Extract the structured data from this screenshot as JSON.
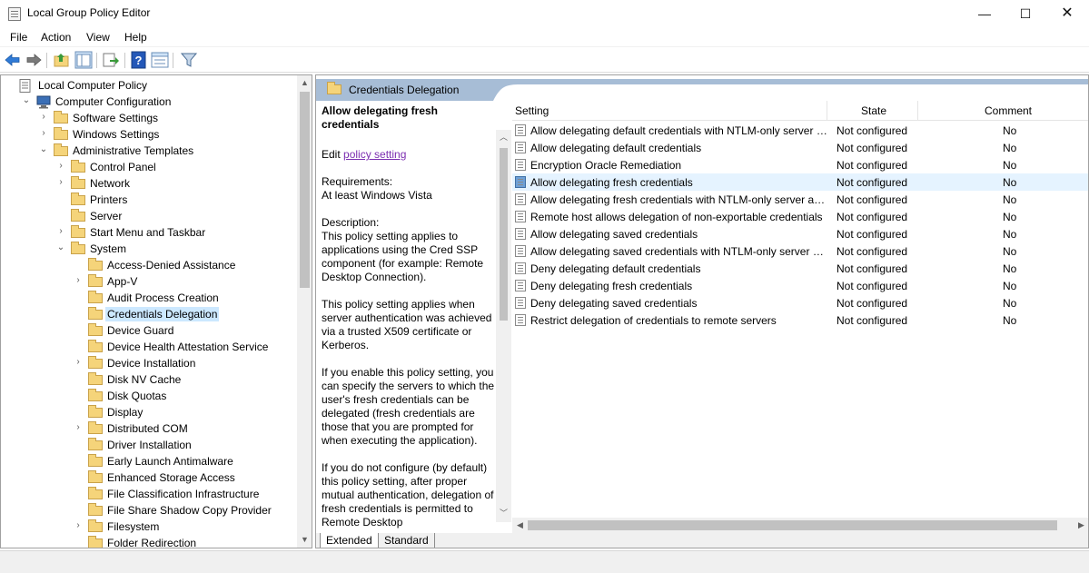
{
  "window": {
    "title": "Local Group Policy Editor",
    "minimize_glyph": "—",
    "maximize_glyph": "☐",
    "close_glyph": "✕"
  },
  "menu": [
    "File",
    "Action",
    "View",
    "Help"
  ],
  "toolbar": {
    "icons": [
      "back-arrow-icon",
      "forward-arrow-icon",
      "up-folder-icon",
      "show-hide-tree-icon",
      "export-list-icon",
      "help-icon",
      "properties-icon",
      "filter-icon"
    ]
  },
  "tree": [
    {
      "label": "Local Computer Policy",
      "expander": "",
      "icon": "policy"
    },
    {
      "label": "Computer Configuration",
      "expander": "⌄",
      "icon": "computer"
    },
    {
      "label": "Software Settings",
      "expander": "›",
      "icon": "folder"
    },
    {
      "label": "Windows Settings",
      "expander": "›",
      "icon": "folder"
    },
    {
      "label": "Administrative Templates",
      "expander": "⌄",
      "icon": "folder"
    },
    {
      "label": "Control Panel",
      "expander": "›",
      "icon": "folder"
    },
    {
      "label": "Network",
      "expander": "›",
      "icon": "folder"
    },
    {
      "label": "Printers",
      "expander": "",
      "icon": "folder"
    },
    {
      "label": "Server",
      "expander": "",
      "icon": "folder"
    },
    {
      "label": "Start Menu and Taskbar",
      "expander": "›",
      "icon": "folder"
    },
    {
      "label": "System",
      "expander": "⌄",
      "icon": "folder"
    },
    {
      "label": "Access-Denied Assistance",
      "expander": "",
      "icon": "folder"
    },
    {
      "label": "App-V",
      "expander": "›",
      "icon": "folder"
    },
    {
      "label": "Audit Process Creation",
      "expander": "",
      "icon": "folder"
    },
    {
      "label": "Credentials Delegation",
      "expander": "",
      "icon": "folder",
      "selected": true
    },
    {
      "label": "Device Guard",
      "expander": "",
      "icon": "folder"
    },
    {
      "label": "Device Health Attestation Service",
      "expander": "",
      "icon": "folder"
    },
    {
      "label": "Device Installation",
      "expander": "›",
      "icon": "folder"
    },
    {
      "label": "Disk NV Cache",
      "expander": "",
      "icon": "folder"
    },
    {
      "label": "Disk Quotas",
      "expander": "",
      "icon": "folder"
    },
    {
      "label": "Display",
      "expander": "",
      "icon": "folder"
    },
    {
      "label": "Distributed COM",
      "expander": "›",
      "icon": "folder"
    },
    {
      "label": "Driver Installation",
      "expander": "",
      "icon": "folder"
    },
    {
      "label": "Early Launch Antimalware",
      "expander": "",
      "icon": "folder"
    },
    {
      "label": "Enhanced Storage Access",
      "expander": "",
      "icon": "folder"
    },
    {
      "label": "File Classification Infrastructure",
      "expander": "",
      "icon": "folder"
    },
    {
      "label": "File Share Shadow Copy Provider",
      "expander": "",
      "icon": "folder"
    },
    {
      "label": "Filesystem",
      "expander": "›",
      "icon": "folder"
    },
    {
      "label": "Folder Redirection",
      "expander": "",
      "icon": "folder"
    }
  ],
  "header": {
    "title": "Credentials Delegation"
  },
  "description": {
    "title": "Allow delegating fresh credentials",
    "edit_prefix": "Edit ",
    "edit_link": "policy setting",
    "requirements_label": "Requirements:",
    "requirements_value": "At least Windows Vista",
    "description_label": "Description:",
    "paragraphs": [
      "This policy setting applies to applications using the Cred SSP component (for example: Remote Desktop Connection).",
      "This policy setting applies when server authentication was achieved via a trusted X509 certificate or Kerberos.",
      "If you enable this policy setting, you can specify the servers to which the user's fresh credentials can be delegated (fresh credentials are those that you are prompted for when executing the application).",
      "If you do not configure (by default) this policy setting, after proper mutual authentication, delegation of fresh credentials is permitted to Remote Desktop"
    ]
  },
  "list": {
    "columns": {
      "setting": "Setting",
      "state": "State",
      "comment": "Comment"
    },
    "rows": [
      {
        "setting": "Allow delegating default credentials with NTLM-only server authentication",
        "state": "Not configured",
        "comment": "No"
      },
      {
        "setting": "Allow delegating default credentials",
        "state": "Not configured",
        "comment": "No"
      },
      {
        "setting": "Encryption Oracle Remediation",
        "state": "Not configured",
        "comment": "No"
      },
      {
        "setting": "Allow delegating fresh credentials",
        "state": "Not configured",
        "comment": "No",
        "selected": true
      },
      {
        "setting": "Allow delegating fresh credentials with NTLM-only server authentication",
        "state": "Not configured",
        "comment": "No"
      },
      {
        "setting": "Remote host allows delegation of non-exportable credentials",
        "state": "Not configured",
        "comment": "No"
      },
      {
        "setting": "Allow delegating saved credentials",
        "state": "Not configured",
        "comment": "No"
      },
      {
        "setting": "Allow delegating saved credentials with NTLM-only server authentication",
        "state": "Not configured",
        "comment": "No"
      },
      {
        "setting": "Deny delegating default credentials",
        "state": "Not configured",
        "comment": "No"
      },
      {
        "setting": "Deny delegating fresh credentials",
        "state": "Not configured",
        "comment": "No"
      },
      {
        "setting": "Deny delegating saved credentials",
        "state": "Not configured",
        "comment": "No"
      },
      {
        "setting": "Restrict delegation of credentials to remote servers",
        "state": "Not configured",
        "comment": "No"
      }
    ]
  },
  "tabs": [
    "Extended",
    "Standard"
  ],
  "colors": {
    "header_band": "#a7bdd6",
    "tree_selection": "#cce8ff",
    "row_selection": "#e5f3ff",
    "link": "#7b2db0"
  }
}
